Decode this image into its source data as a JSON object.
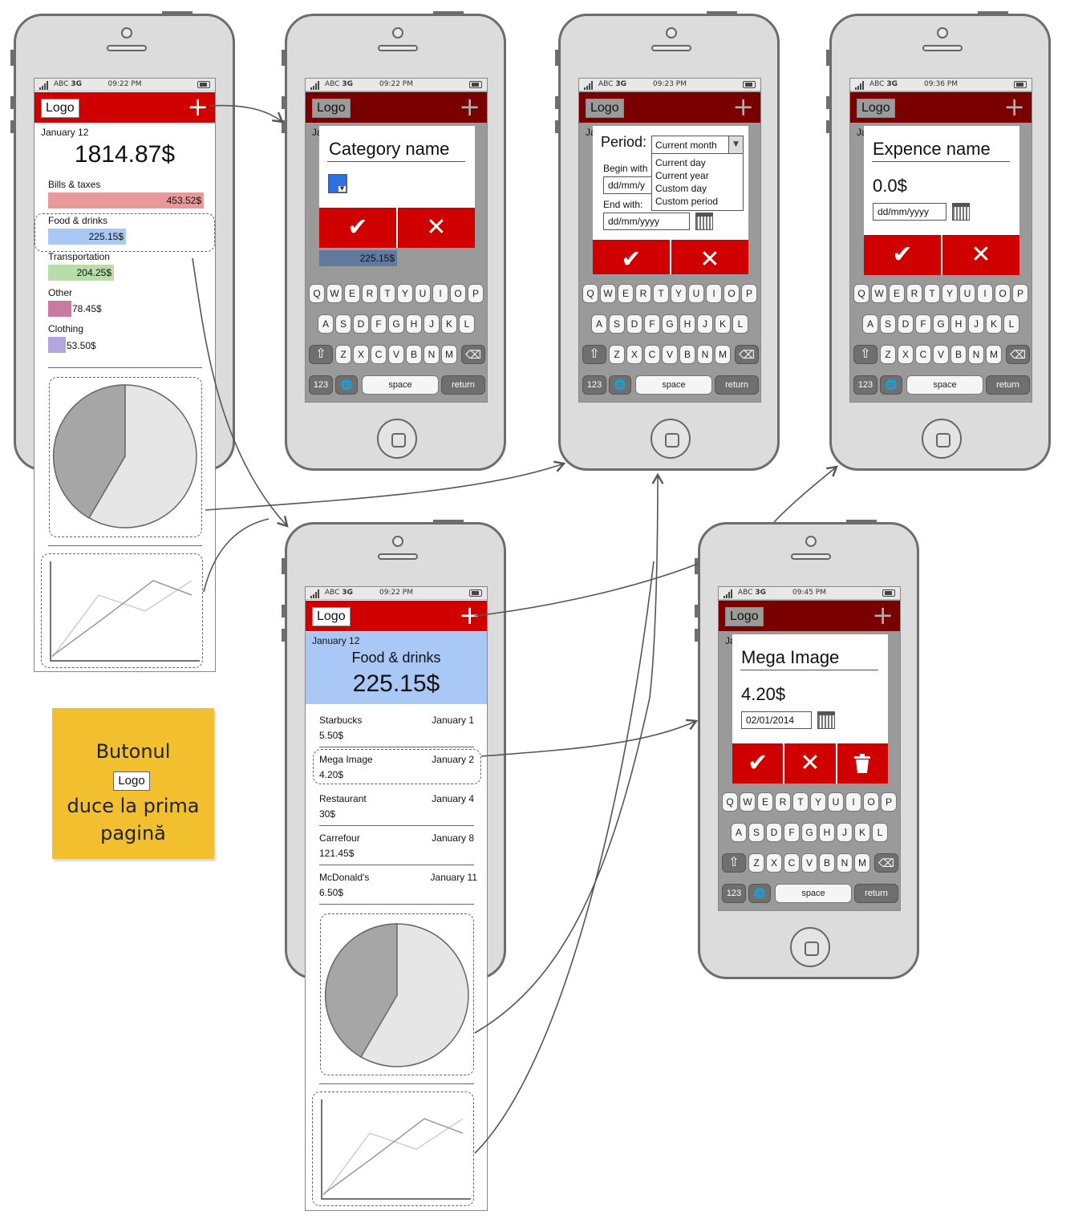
{
  "status": {
    "carrier": "ABC",
    "network": "3G"
  },
  "common": {
    "logo": "Logo",
    "plus": "+",
    "ok": "✔",
    "cancel": "✕",
    "delete": "🗑"
  },
  "keyboard": {
    "row1": [
      "Q",
      "W",
      "E",
      "R",
      "T",
      "Y",
      "U",
      "I",
      "O",
      "P"
    ],
    "row2": [
      "A",
      "S",
      "D",
      "F",
      "G",
      "H",
      "J",
      "K",
      "L"
    ],
    "row3": [
      "Z",
      "X",
      "C",
      "V",
      "B",
      "N",
      "M"
    ],
    "num": "123",
    "space": "space",
    "return": "return"
  },
  "screen_home": {
    "time": "09:22 PM",
    "date": "January 12",
    "total": "1814.87$",
    "categories": [
      {
        "label": "Bills & taxes",
        "value": "453.52$",
        "color": "#e89a9a"
      },
      {
        "label": "Food & drinks",
        "value": "225.15$",
        "color": "#a9c8f5"
      },
      {
        "label": "Transportation",
        "value": "204.25$",
        "color": "#b8dcaa"
      },
      {
        "label": "Other",
        "value": "78.45$",
        "color": "#c97aa0"
      },
      {
        "label": "Clothing",
        "value": "53.50$",
        "color": "#b3a6dd"
      }
    ]
  },
  "screen_category": {
    "time": "09:22 PM",
    "title": "Category name",
    "under_value": "225.15$",
    "partial_label": "Ja"
  },
  "screen_period": {
    "time": "09:23 PM",
    "period_label": "Period:",
    "selected": "Current month",
    "options": [
      "Current day",
      "Current year",
      "Custom day",
      "Custom period"
    ],
    "begin_label": "Begin with",
    "begin_value": "dd/mm/y",
    "end_label": "End with:",
    "end_value": "dd/mm/yyyy",
    "partial_label": "Ja"
  },
  "screen_expense": {
    "time": "09:36 PM",
    "title": "Expence name",
    "amount": "0.0$",
    "date_value": "dd/mm/yyyy",
    "partial_label": "Ja"
  },
  "screen_food": {
    "time": "09:22 PM",
    "date": "January 12",
    "category": "Food & drinks",
    "total": "225.15$",
    "items": [
      {
        "name": "Starbucks",
        "date": "January 1",
        "amount": "5.50$"
      },
      {
        "name": "Mega Image",
        "date": "January 2",
        "amount": "4.20$"
      },
      {
        "name": "Restaurant",
        "date": "January 4",
        "amount": "30$"
      },
      {
        "name": "Carrefour",
        "date": "January 8",
        "amount": "121.45$"
      },
      {
        "name": "McDonald's",
        "date": "January 11",
        "amount": "6.50$"
      }
    ]
  },
  "screen_edit": {
    "time": "09:45 PM",
    "title": "Mega Image",
    "amount": "4.20$",
    "date_value": "02/01/2014",
    "partial_label": "Ja"
  },
  "note": {
    "line1": "Butonul",
    "logo": "Logo",
    "line2": "duce la prima",
    "line3": "pagină"
  }
}
